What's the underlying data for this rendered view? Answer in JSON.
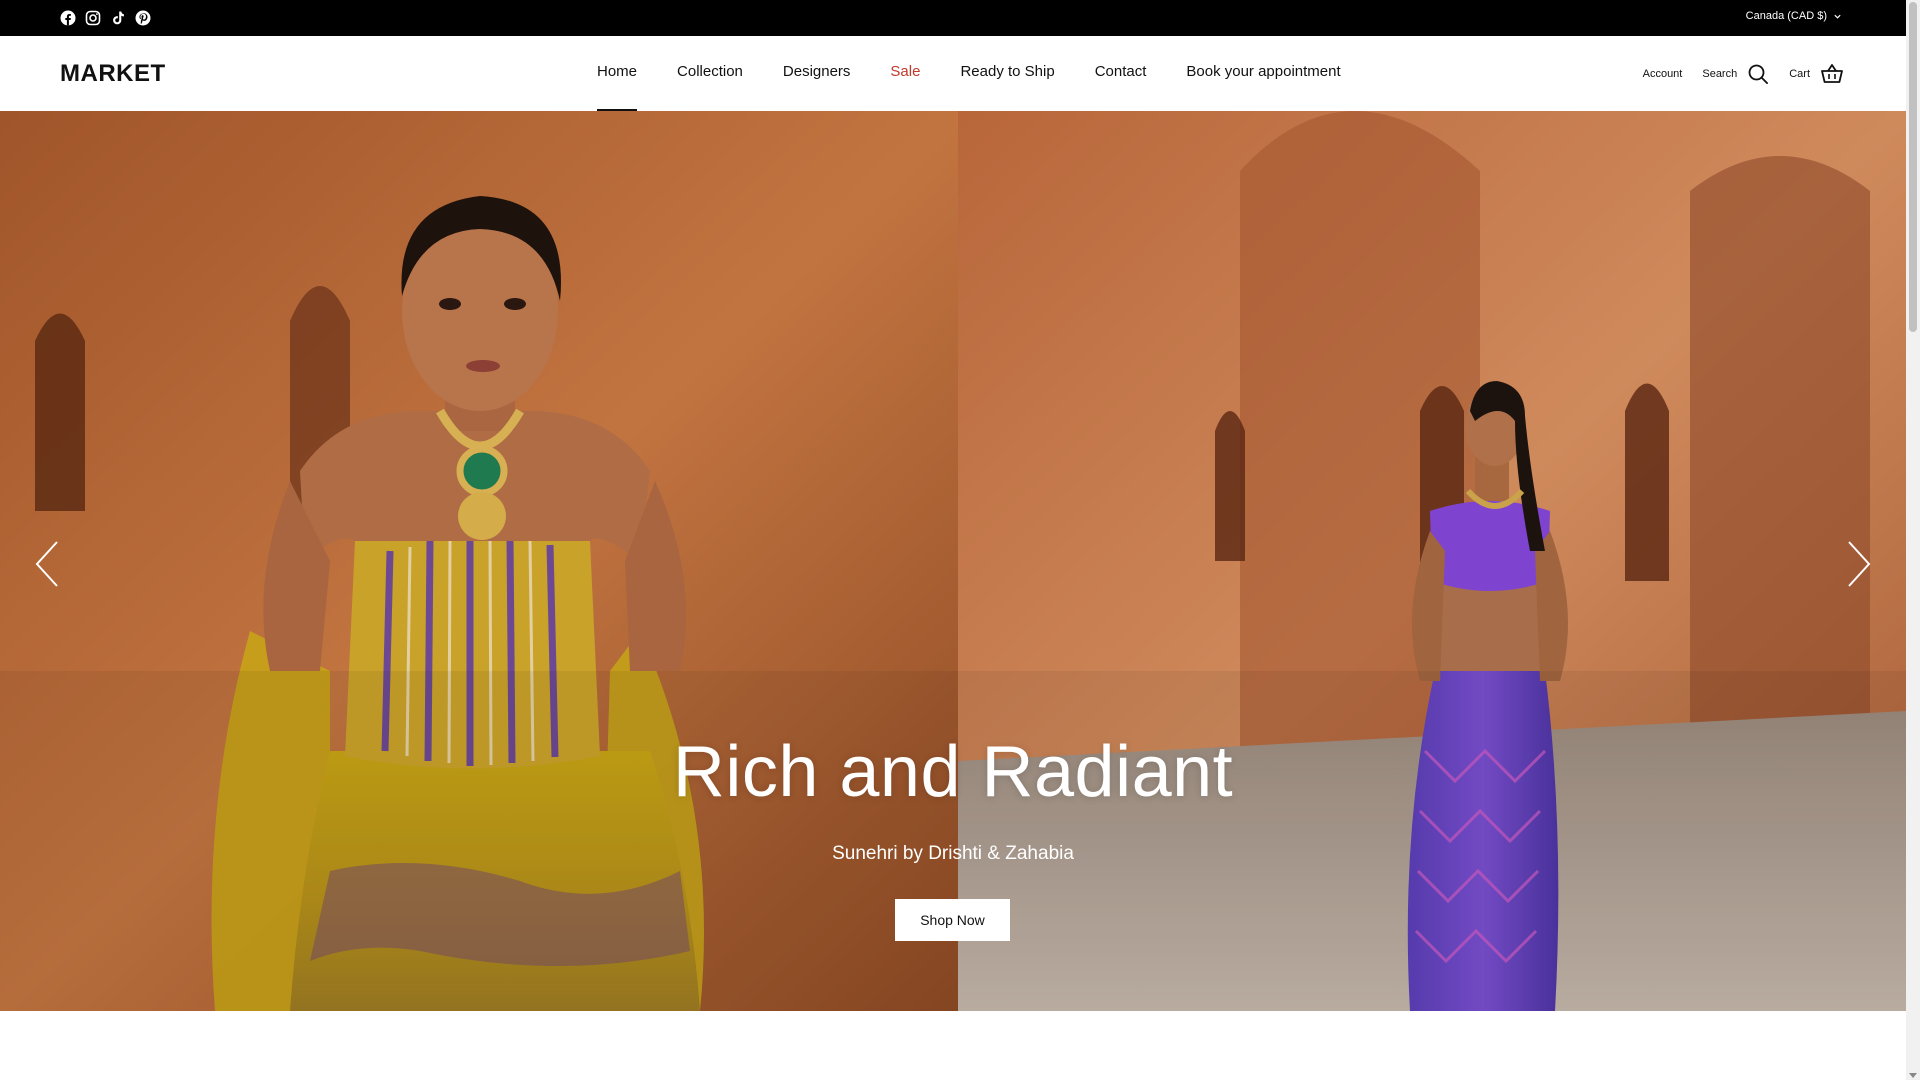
{
  "topbar": {
    "social_icons": [
      "facebook-icon",
      "instagram-icon",
      "tiktok-icon",
      "pinterest-icon"
    ],
    "currency_label": "Canada (CAD $)"
  },
  "header": {
    "logo": "MARKET",
    "nav": [
      {
        "label": "Home",
        "active": true
      },
      {
        "label": "Collection"
      },
      {
        "label": "Designers"
      },
      {
        "label": "Sale",
        "color": "#c0392b"
      },
      {
        "label": "Ready to Ship"
      },
      {
        "label": "Contact"
      },
      {
        "label": "Book your appointment"
      }
    ],
    "account_label": "Account",
    "search_label": "Search",
    "cart_label": "Cart"
  },
  "hero": {
    "title": "Rich and Radiant",
    "subtitle": "Sunehri by Drishti & Zahabia",
    "cta_label": "Shop Now"
  },
  "colors": {
    "topbar_bg": "#000000",
    "sale_red": "#c0392b",
    "hero_wall": "#b9693a"
  }
}
